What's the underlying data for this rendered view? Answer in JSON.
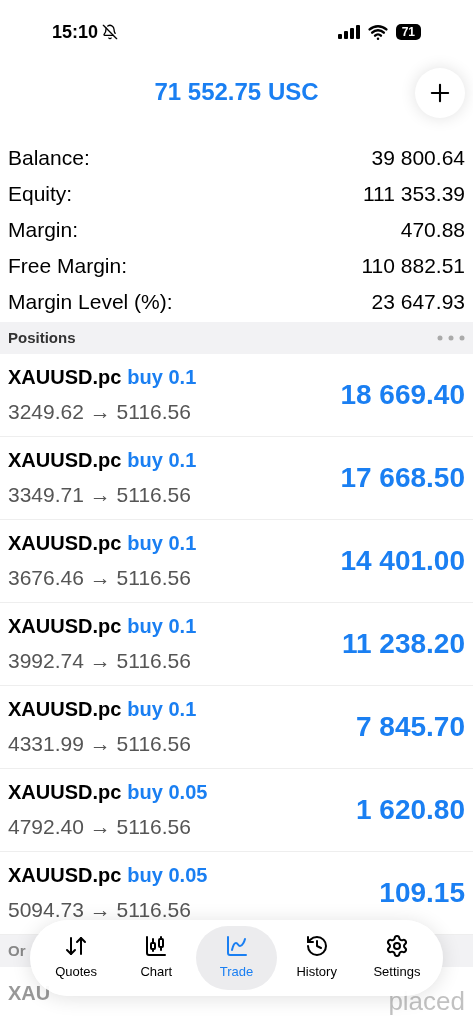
{
  "status_bar": {
    "time": "15:10",
    "battery": "71"
  },
  "header": {
    "equity_title": "71 552.75 USC"
  },
  "summary": [
    {
      "label": "Balance:",
      "value": "39 800.64"
    },
    {
      "label": "Equity:",
      "value": "111 353.39"
    },
    {
      "label": "Margin:",
      "value": "470.88"
    },
    {
      "label": "Free Margin:",
      "value": "110 882.51"
    },
    {
      "label": "Margin Level (%):",
      "value": "23 647.93"
    }
  ],
  "positions_section": {
    "title": "Positions"
  },
  "positions": [
    {
      "symbol": "XAUUSD.pc",
      "side": "buy 0.1",
      "prices": "3249.62 → 5116.56",
      "profit": "18 669.40"
    },
    {
      "symbol": "XAUUSD.pc",
      "side": "buy 0.1",
      "prices": "3349.71 → 5116.56",
      "profit": "17 668.50"
    },
    {
      "symbol": "XAUUSD.pc",
      "side": "buy 0.1",
      "prices": "3676.46 → 5116.56",
      "profit": "14 401.00"
    },
    {
      "symbol": "XAUUSD.pc",
      "side": "buy 0.1",
      "prices": "3992.74 → 5116.56",
      "profit": "11 238.20"
    },
    {
      "symbol": "XAUUSD.pc",
      "side": "buy 0.1",
      "prices": "4331.99 → 5116.56",
      "profit": "7 845.70"
    },
    {
      "symbol": "XAUUSD.pc",
      "side": "buy 0.05",
      "prices": "4792.40 → 5116.56",
      "profit": "1 620.80"
    },
    {
      "symbol": "XAUUSD.pc",
      "side": "buy 0.05",
      "prices": "5094.73 → 5116.56",
      "profit": "109.15"
    }
  ],
  "orders_section": {
    "title": "Or"
  },
  "orders": [
    {
      "symbol": "XAU",
      "status": "placed"
    }
  ],
  "tab_bar": [
    {
      "kind": "quotes",
      "label": "Quotes",
      "selected": false
    },
    {
      "kind": "chart",
      "label": "Chart",
      "selected": false
    },
    {
      "kind": "trade",
      "label": "Trade",
      "selected": true
    },
    {
      "kind": "history",
      "label": "History",
      "selected": false
    },
    {
      "kind": "settings",
      "label": "Settings",
      "selected": false
    }
  ]
}
